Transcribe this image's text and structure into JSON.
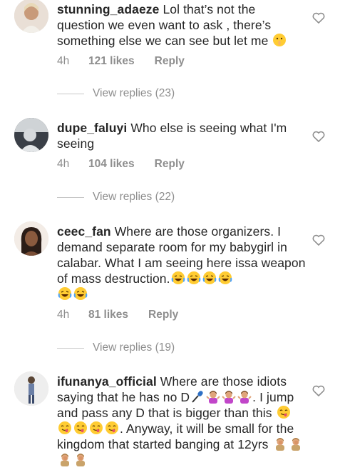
{
  "comments": [
    {
      "username": "stunning_adaeze",
      "text": "Lol that’s not the question we even want to ask , there’s something else we can see but let me",
      "time": "4h",
      "likes": "121 likes",
      "reply": "Reply",
      "view_replies": "View replies (23)",
      "emoji": [
        "shushing-face"
      ]
    },
    {
      "username": "dupe_faluyi",
      "text": "Who else is seeing what I'm seeing",
      "time": "4h",
      "likes": "104 likes",
      "reply": "Reply",
      "view_replies": "View replies (22)"
    },
    {
      "username": "ceec_fan",
      "text": "Where are those organizers. I demand separate room for my babygirl in calabar. What I am seeing here issa weapon of mass destruction.",
      "time": "4h",
      "likes": "81 likes",
      "reply": "Reply",
      "view_replies": "View replies (19)",
      "emoji": [
        "laughing-face",
        "laughing-face",
        "laughing-face",
        "laughing-face",
        "laughing-face",
        "laughing-face"
      ]
    },
    {
      "username": "ifunanya_official",
      "text_part1": "Where are those idiots saying that he has no D",
      "text_part2": ". I jump  and pass any D that is bigger than this",
      "text_part3": ". Anyway, it will be small for the kingdom that started banging at 12yrs",
      "emoji_after_d": [
        "microphone",
        "woman-shrugging",
        "woman-shrugging",
        "woman-shrugging"
      ],
      "emoji_after_this": [
        "yum-face",
        "yum-face",
        "yum-face",
        "yum-face",
        "yum-face"
      ],
      "emoji_end": [
        "woman-facepalming",
        "woman-facepalming",
        "woman-facepalming",
        "woman-facepalming"
      ]
    }
  ],
  "colors": {
    "text": "#262626",
    "muted": "#8e8e8e",
    "background": "#ffffff"
  }
}
